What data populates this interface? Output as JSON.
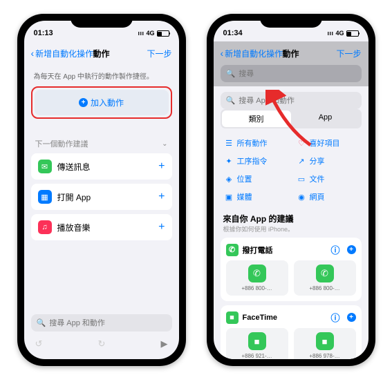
{
  "left": {
    "status": {
      "time": "01:13",
      "carrier_text": "4G",
      "battery_pct": "31"
    },
    "nav": {
      "back": "新增自動化操作",
      "title": "動作",
      "next": "下一步"
    },
    "description": "為每天在 App 中執行的動作製作捷徑。",
    "add_action_label": "加入動作",
    "suggestions_header": "下一個動作建議",
    "suggestions": [
      {
        "icon_class": "sg-green",
        "icon_glyph": "✉",
        "label": "傳送訊息"
      },
      {
        "icon_class": "sg-blue",
        "icon_glyph": "▦",
        "label": "打開 App"
      },
      {
        "icon_class": "sg-red",
        "icon_glyph": "♫",
        "label": "播放音樂"
      }
    ],
    "search_placeholder": "搜尋 App 和動作"
  },
  "right": {
    "status": {
      "time": "01:34",
      "carrier_text": "4G",
      "battery_pct": "30"
    },
    "nav": {
      "back": "新增自動化操作",
      "title": "動作",
      "next": "下一步"
    },
    "search_active_placeholder": "搜尋",
    "search_placeholder": "搜尋 App 和動作",
    "segment": {
      "left": "類別",
      "right": "App"
    },
    "categories": {
      "col1": [
        {
          "glyph": "☰",
          "label": "所有動作"
        },
        {
          "glyph": "✦",
          "label": "工序指令"
        },
        {
          "glyph": "◈",
          "label": "位置"
        },
        {
          "glyph": "▣",
          "label": "媒體"
        }
      ],
      "col2": [
        {
          "glyph": "♡",
          "label": "喜好項目"
        },
        {
          "glyph": "↗",
          "label": "分享"
        },
        {
          "glyph": "▭",
          "label": "文件"
        },
        {
          "glyph": "◉",
          "label": "網頁"
        }
      ]
    },
    "rec_title": "來自你 App 的建議",
    "rec_sub": "根據你如何使用 iPhone。",
    "rec_cards": [
      {
        "icon_class": "sg-green",
        "icon_glyph": "✆",
        "title": "撥打電話",
        "contacts": [
          {
            "glyph": "✆",
            "label": "+886 800-…"
          },
          {
            "glyph": "✆",
            "label": "+886 800-…"
          }
        ]
      },
      {
        "icon_class": "sg-green",
        "icon_glyph": "■",
        "title": "FaceTime",
        "contacts": [
          {
            "glyph": "■",
            "label": "+886 921-…"
          },
          {
            "glyph": "■",
            "label": "+886 978-…"
          }
        ]
      }
    ]
  }
}
